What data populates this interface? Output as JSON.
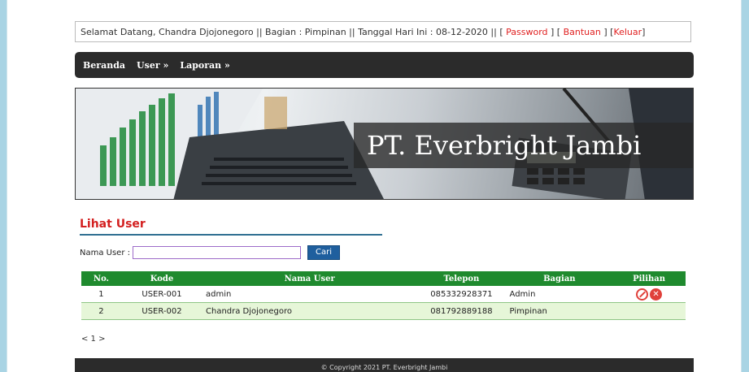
{
  "topbar": {
    "greeting": "Selamat Datang, Chandra Djojonegoro || Bagian : Pimpinan || Tanggal Hari Ini : 08-12-2020 || [ ",
    "password": "Password",
    "sep1": " ] [ ",
    "bantuan": "Bantuan",
    "sep2": " ] [",
    "keluar": "Keluar",
    "end": "]"
  },
  "nav": {
    "items": [
      "Beranda",
      "User »",
      "Laporan »"
    ]
  },
  "banner": {
    "title": "PT. Everbright Jambi"
  },
  "main": {
    "heading": "Lihat User",
    "search_label": "Nama User :",
    "search_value": "",
    "search_button": "Cari"
  },
  "table": {
    "headers": [
      "No.",
      "Kode",
      "Nama User",
      "Telepon",
      "Bagian",
      "Pilihan"
    ],
    "rows": [
      {
        "no": "1",
        "kode": "USER-001",
        "nama": "admin",
        "telepon": "085332928371",
        "bagian": "Admin"
      },
      {
        "no": "2",
        "kode": "USER-002",
        "nama": "Chandra Djojonegoro",
        "telepon": "081792889188",
        "bagian": "Pimpinan"
      }
    ],
    "edit_icon": "edit-icon",
    "delete_icon": "delete-icon"
  },
  "pager": "< 1 >",
  "footer": "© Copyright 2021 PT. Everbright Jambi",
  "colors": {
    "background": "#a9d4e4",
    "nav": "#2b2b2b",
    "table_header": "#1f8a2e",
    "heading": "#d32020",
    "link": "#e02020"
  }
}
